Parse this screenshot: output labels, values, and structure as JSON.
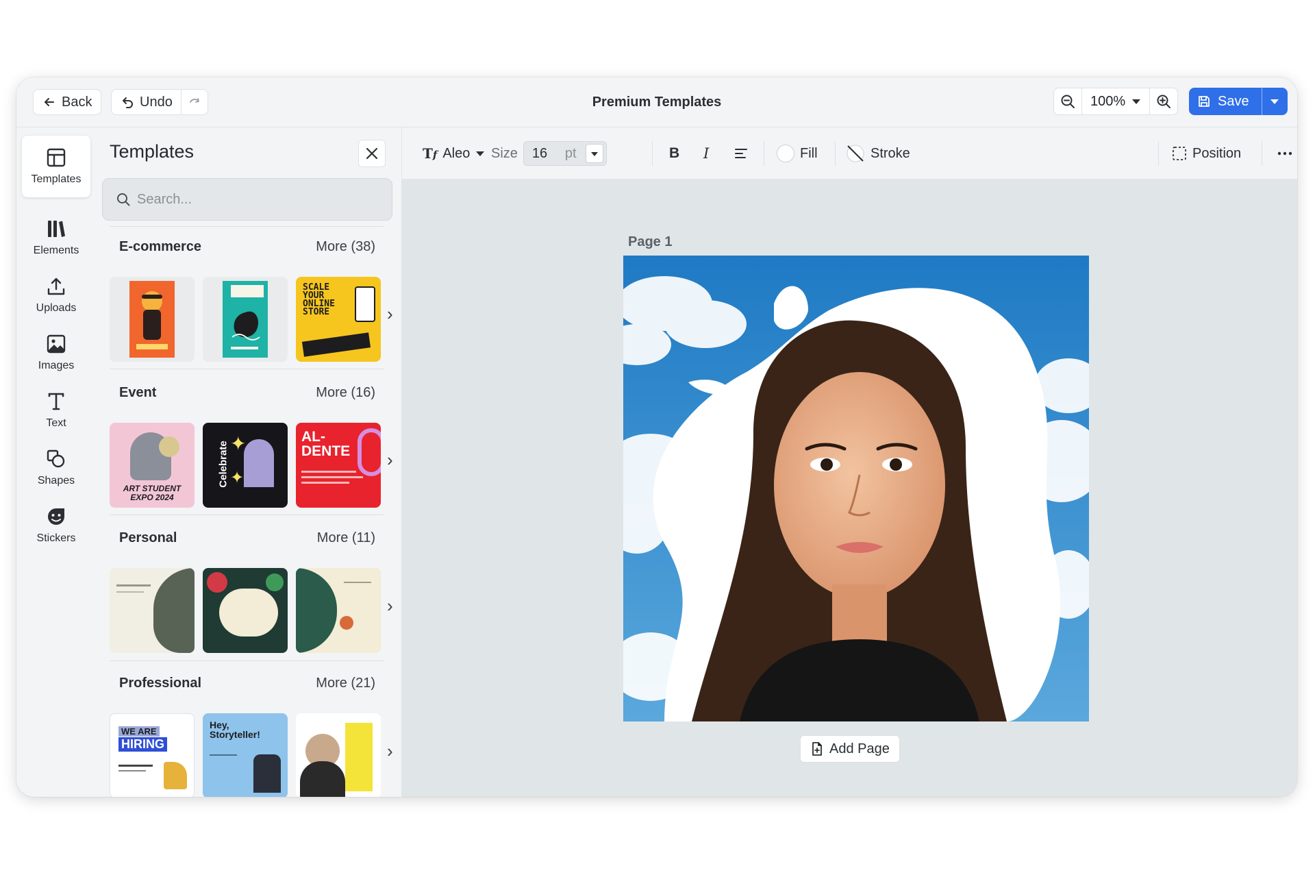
{
  "header": {
    "back_label": "Back",
    "undo_label": "Undo",
    "title": "Premium Templates",
    "zoom": "100%",
    "save_label": "Save"
  },
  "rail": {
    "items": [
      {
        "label": "Templates",
        "icon": "layout-icon"
      },
      {
        "label": "Elements",
        "icon": "elements-icon"
      },
      {
        "label": "Uploads",
        "icon": "upload-icon"
      },
      {
        "label": "Images",
        "icon": "image-icon"
      },
      {
        "label": "Text",
        "icon": "text-icon"
      },
      {
        "label": "Shapes",
        "icon": "shapes-icon"
      },
      {
        "label": "Stickers",
        "icon": "sticker-icon"
      }
    ]
  },
  "panel": {
    "title": "Templates",
    "search_placeholder": "Search...",
    "sections": [
      {
        "name": "E-commerce",
        "more": "More (38)"
      },
      {
        "name": "Event",
        "more": "More (16)"
      },
      {
        "name": "Personal",
        "more": "More (11)"
      },
      {
        "name": "Professional",
        "more": "More (21)"
      }
    ],
    "thumb_text": {
      "ecom_3": [
        "SCALE",
        "YOUR",
        "ONLINE",
        "STORE"
      ],
      "event_1": "ART STUDENT EXPO 2024",
      "event_2": "Celebrate",
      "event_3": [
        "AL-",
        "DENTE"
      ],
      "pro_1": [
        "WE ARE",
        "HIRING"
      ],
      "pro_2": [
        "Hey,",
        "Storyteller!"
      ]
    }
  },
  "format": {
    "font": "Aleo",
    "size_label": "Size",
    "size_value": "16",
    "size_unit": "pt",
    "fill_label": "Fill",
    "stroke_label": "Stroke",
    "position_label": "Position"
  },
  "canvas": {
    "page_label": "Page 1",
    "add_page_label": "Add Page"
  },
  "colors": {
    "accent": "#2f6fe8",
    "sky": "#3a8fcf"
  }
}
